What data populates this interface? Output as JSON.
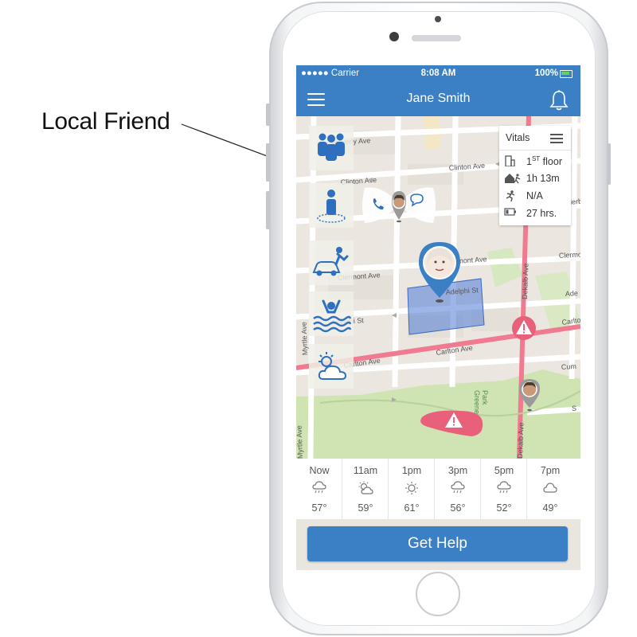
{
  "annotation": {
    "label": "Local Friend"
  },
  "statusbar": {
    "carrier": "●●●●● Carrier",
    "time": "8:08 AM",
    "battery": "100%"
  },
  "header": {
    "title": "Jane Smith"
  },
  "map": {
    "streets": [
      "Waverly Ave",
      "Clinton Ave",
      "Clinton Ave",
      "Vanderb",
      "Clermont Ave",
      "Clermont Ave",
      "Clermo",
      "Adelphi St",
      "Adelphi St",
      "Ade",
      "Carlton Ave",
      "Carlton Ave",
      "Carlto",
      "Cum",
      "S",
      "Myrtle Ave",
      "Myrtle Ave",
      "Greene Park",
      "Dekalb Ave",
      "Dekalb Ave"
    ]
  },
  "side_icons": [
    "group-icon",
    "person-geofence-icon",
    "car-accident-icon",
    "drowning-icon",
    "weather-icon"
  ],
  "vitals": {
    "title": "Vitals",
    "rows": [
      {
        "icon": "building-icon",
        "value": "1",
        "sup": "ST",
        "suffix": " floor"
      },
      {
        "icon": "home-exit-icon",
        "value": "1h 13m"
      },
      {
        "icon": "running-icon",
        "value": "N/A"
      },
      {
        "icon": "battery-icon",
        "value": "27 hrs."
      }
    ]
  },
  "weather": [
    {
      "time": "Now",
      "icon": "rain-cloud-icon",
      "temp": "57°"
    },
    {
      "time": "11am",
      "icon": "partly-cloudy-icon",
      "temp": "59°"
    },
    {
      "time": "1pm",
      "icon": "sun-icon",
      "temp": "61°"
    },
    {
      "time": "3pm",
      "icon": "rain-cloud-icon",
      "temp": "56°"
    },
    {
      "time": "5pm",
      "icon": "rain-cloud-icon",
      "temp": "52°"
    },
    {
      "time": "7pm",
      "icon": "cloud-icon",
      "temp": "49°"
    }
  ],
  "actions": {
    "get_help": "Get Help"
  },
  "colors": {
    "brand": "#3b7fc4",
    "alert": "#e8607a",
    "park": "#cfe3b3",
    "geofence": "#5b84d8"
  }
}
